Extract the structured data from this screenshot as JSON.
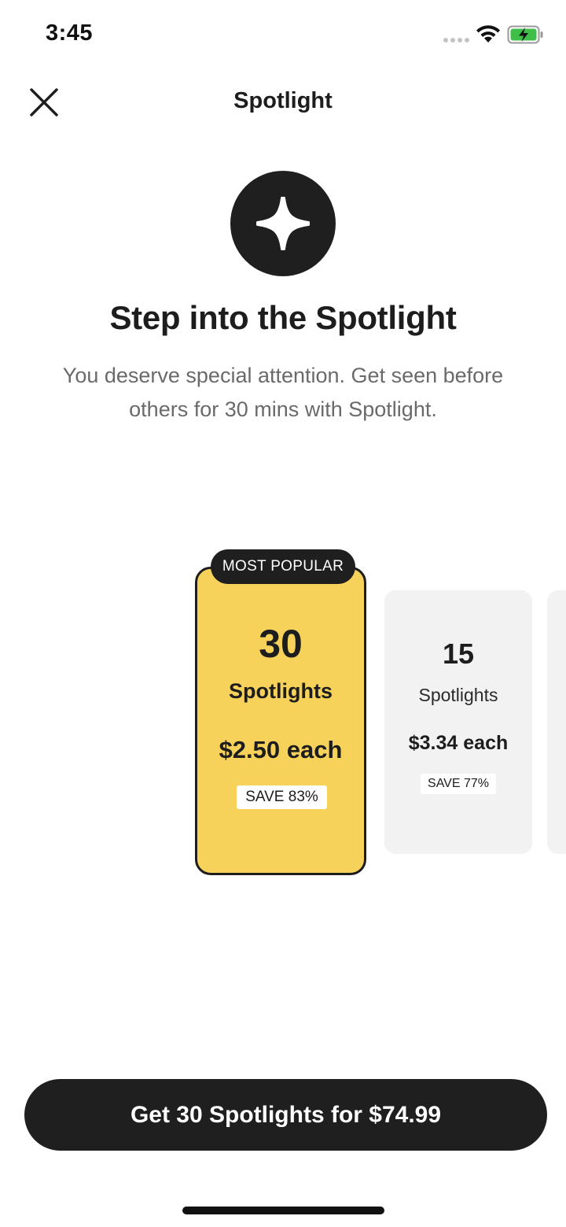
{
  "status_bar": {
    "time": "3:45",
    "battery_color": "#3fbf4a"
  },
  "header": {
    "title": "Spotlight",
    "close_icon": "close-icon"
  },
  "hero": {
    "icon": "sparkle-icon",
    "headline": "Step into the Spotlight",
    "subtitle": "You deserve special attention. Get seen before others for 30 mins with Spotlight."
  },
  "plans": [
    {
      "badge": "MOST POPULAR",
      "quantity": "30",
      "unit": "Spotlights",
      "price": "$2.50 each",
      "save": "SAVE 83%",
      "selected": true
    },
    {
      "quantity": "15",
      "unit": "Spotlights",
      "price": "$3.34 each",
      "save": "SAVE 77%",
      "selected": false
    }
  ],
  "cta": {
    "label": "Get 30 Spotlights for $74.99"
  },
  "colors": {
    "accent": "#f7d25a",
    "dark": "#1f1f1f",
    "card_bg": "#f2f2f2"
  }
}
